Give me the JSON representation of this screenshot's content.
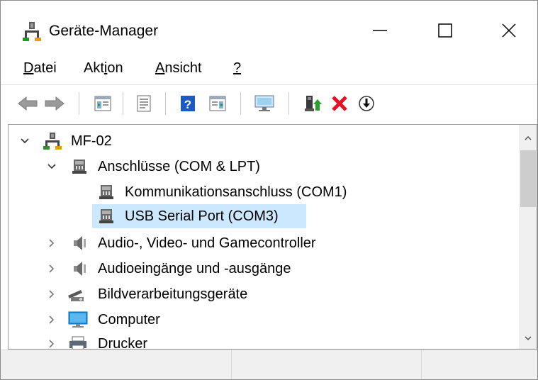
{
  "window": {
    "title": "Geräte-Manager",
    "minimize_icon": "minimize-icon",
    "maximize_icon": "maximize-icon",
    "close_icon": "close-icon"
  },
  "menu": {
    "items": [
      {
        "label_ul": "D",
        "label_rest": "atei"
      },
      {
        "label_pre": "Akt",
        "label_ul": "i",
        "label_rest": "on"
      },
      {
        "label_ul": "A",
        "label_rest": "nsicht"
      },
      {
        "label_ul": "?"
      }
    ]
  },
  "toolbar": {
    "buttons": [
      "back-icon",
      "forward-icon",
      "properties-view-icon",
      "device-properties-icon",
      "help-icon",
      "action-pane-icon",
      "scan-hardware-icon",
      "update-driver-icon",
      "uninstall-icon",
      "enable-device-icon"
    ]
  },
  "tree": {
    "root": {
      "label": "MF-02",
      "expanded": true
    },
    "nodes": [
      {
        "label": "Anschlüsse (COM & LPT)",
        "expanded": true,
        "level": 1
      },
      {
        "label": "Kommunikationsanschluss (COM1)",
        "level": 2
      },
      {
        "label": "USB Serial Port (COM3)",
        "level": 2,
        "selected": true
      },
      {
        "label": "Audio-, Video- und Gamecontroller",
        "expanded": false,
        "level": 1
      },
      {
        "label": "Audioeingänge und -ausgänge",
        "expanded": false,
        "level": 1
      },
      {
        "label": "Bildverarbeitungsgeräte",
        "expanded": false,
        "level": 1
      },
      {
        "label": "Computer",
        "expanded": false,
        "level": 1
      },
      {
        "label": "Drucker",
        "expanded": false,
        "level": 1
      }
    ]
  },
  "colors": {
    "selection": "#cce8ff",
    "delete_red": "#e81123",
    "help_blue": "#1b59c4"
  }
}
